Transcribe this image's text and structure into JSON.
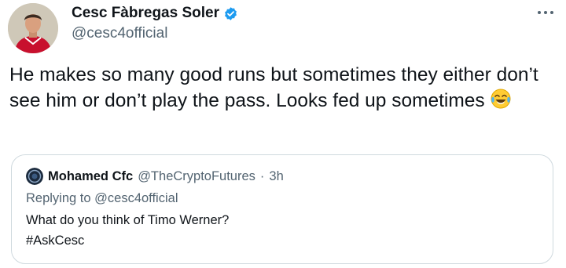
{
  "author": {
    "name": "Cesc Fàbregas Soler",
    "handle": "@cesc4official",
    "verified": true
  },
  "more_icon": "more-horizontal-icon",
  "tweet": {
    "text": "He makes so many good runs but sometimes they either don’t see him or don’t play the pass. Looks fed up sometimes",
    "emoji": "face-with-tears-of-joy"
  },
  "quoted_tweet": {
    "author_name": "Mohamed Cfc",
    "author_handle": "@TheCryptoFutures",
    "separator": "·",
    "time": "3h",
    "replying_prefix": "Replying to",
    "replying_to": "@cesc4official",
    "text_line1": "What do you think of Timo Werner?",
    "text_line2": "#AskCesc"
  },
  "colors": {
    "verified_blue": "#1d9bf0",
    "secondary_text": "#536471",
    "border": "#cfd9de",
    "avatar_kit_red": "#c8102e"
  }
}
